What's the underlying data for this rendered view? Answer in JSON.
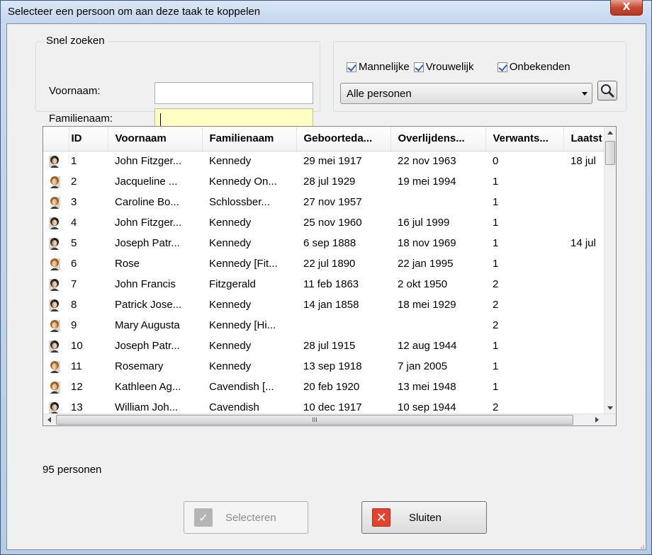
{
  "window": {
    "title": "Selecteer een persoon om aan deze taak te koppelen",
    "close_glyph": "X"
  },
  "quick_search": {
    "legend": "Snel zoeken",
    "first_name_label": "Voornaam:",
    "first_name_value": "",
    "last_name_label": "Familienaam:",
    "last_name_value": ""
  },
  "filters": {
    "male_label": "Mannelijke",
    "male_checked": true,
    "female_label": "Vrouwelijk",
    "female_checked": true,
    "unknown_label": "Onbekenden",
    "unknown_checked": true,
    "scope_selected": "Alle personen"
  },
  "table": {
    "columns": [
      "ID",
      "Voornaam",
      "Familienaam",
      "Geboorteda...",
      "Overlijdens...",
      "Verwants...",
      "Laatst"
    ],
    "rows": [
      {
        "icon": "male-person-icon",
        "id": "1",
        "first": "John Fitzger...",
        "last": "Kennedy",
        "birth": "29 mei 1917",
        "death": "22 nov 1963",
        "rel": "0",
        "latest": "18 jul"
      },
      {
        "icon": "female-person-icon",
        "id": "2",
        "first": "Jacqueline ...",
        "last": "Kennedy On...",
        "birth": "28 jul 1929",
        "death": "19 mei 1994",
        "rel": "1",
        "latest": ""
      },
      {
        "icon": "female-person-icon",
        "id": "3",
        "first": "Caroline Bo...",
        "last": "Schlossber...",
        "birth": "27 nov 1957",
        "death": "",
        "rel": "1",
        "latest": ""
      },
      {
        "icon": "male-person-icon",
        "id": "4",
        "first": "John Fitzger...",
        "last": "Kennedy",
        "birth": "25 nov 1960",
        "death": "16 jul 1999",
        "rel": "1",
        "latest": ""
      },
      {
        "icon": "male-person-icon",
        "id": "5",
        "first": "Joseph Patr...",
        "last": "Kennedy",
        "birth": "6 sep 1888",
        "death": "18 nov 1969",
        "rel": "1",
        "latest": "14 jul"
      },
      {
        "icon": "female-person-icon",
        "id": "6",
        "first": "Rose",
        "last": "Kennedy [Fit...",
        "birth": "22 jul 1890",
        "death": "22 jan 1995",
        "rel": "1",
        "latest": ""
      },
      {
        "icon": "male-person-icon",
        "id": "7",
        "first": "John Francis",
        "last": "Fitzgerald",
        "birth": "11 feb 1863",
        "death": "2 okt 1950",
        "rel": "2",
        "latest": ""
      },
      {
        "icon": "male-person-icon",
        "id": "8",
        "first": "Patrick Jose...",
        "last": "Kennedy",
        "birth": "14 jan 1858",
        "death": "18 mei 1929",
        "rel": "2",
        "latest": ""
      },
      {
        "icon": "female-person-icon",
        "id": "9",
        "first": "Mary Augusta",
        "last": "Kennedy [Hi...",
        "birth": "",
        "death": "",
        "rel": "2",
        "latest": ""
      },
      {
        "icon": "male-person-icon",
        "id": "10",
        "first": "Joseph Patr...",
        "last": "Kennedy",
        "birth": "28 jul 1915",
        "death": "12 aug 1944",
        "rel": "1",
        "latest": ""
      },
      {
        "icon": "female-person-icon",
        "id": "11",
        "first": "Rosemary",
        "last": "Kennedy",
        "birth": "13 sep 1918",
        "death": "7 jan 2005",
        "rel": "1",
        "latest": ""
      },
      {
        "icon": "female-person-icon",
        "id": "12",
        "first": "Kathleen Ag...",
        "last": "Cavendish [...",
        "birth": "20 feb 1920",
        "death": "13 mei 1948",
        "rel": "1",
        "latest": ""
      },
      {
        "icon": "male-person-icon",
        "id": "13",
        "first": "William Joh...",
        "last": "Cavendish",
        "birth": "10 dec 1917",
        "death": "10 sep 1944",
        "rel": "2",
        "latest": ""
      }
    ],
    "hscroll_grip": "III"
  },
  "status": {
    "count_text": "95 personen"
  },
  "buttons": {
    "select_label": "Selecteren",
    "close_label": "Sluiten"
  },
  "colors": {
    "focus_field": "#ffffc4",
    "close_red": "#e5432f"
  }
}
